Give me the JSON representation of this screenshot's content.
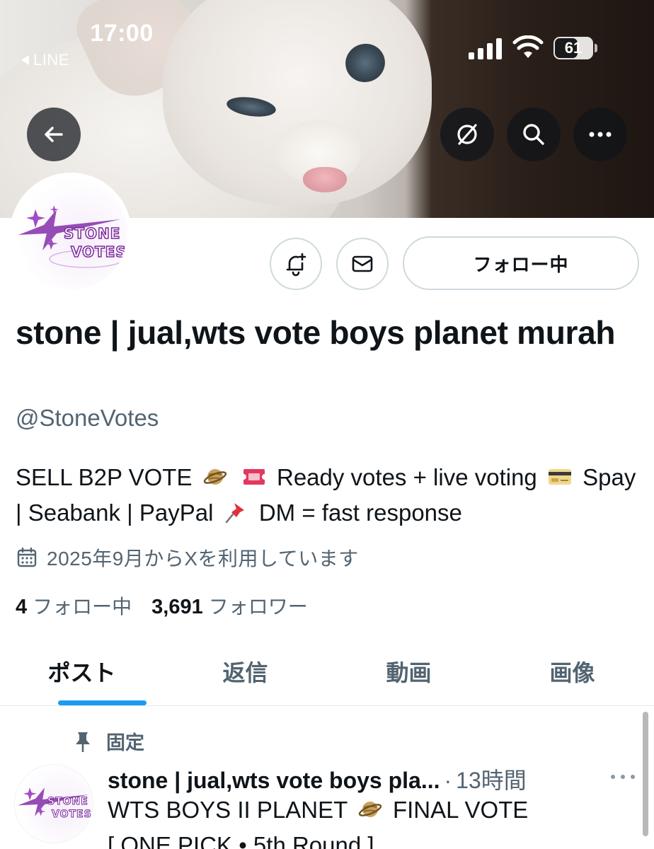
{
  "status_bar": {
    "time": "17:00",
    "back_app": "LINE",
    "battery_level": 61,
    "battery_label": "61"
  },
  "banner": {
    "description_icons": [
      "arrow-left-icon",
      "grok-icon",
      "search-icon",
      "more-icon"
    ]
  },
  "avatar": {
    "logo_line1": "STONE",
    "logo_line2": "VOTES"
  },
  "actions": {
    "following_label": "フォロー中"
  },
  "profile": {
    "display_name": "stone | jual,wts vote boys planet murah",
    "handle": "@StoneVotes",
    "bio": {
      "part1": "SELL B2P VOTE",
      "part2": "Ready votes + live voting",
      "part3": "Spay | Seabank | PayPal",
      "part4": "DM = fast response"
    },
    "joined": "2025年9月からXを利用しています",
    "following_count": "4",
    "following_label": "フォロー中",
    "followers_count": "3,691",
    "followers_label": "フォロワー"
  },
  "tabs": [
    {
      "label": "ポスト",
      "active": true
    },
    {
      "label": "返信",
      "active": false
    },
    {
      "label": "動画",
      "active": false
    },
    {
      "label": "画像",
      "active": false
    }
  ],
  "pinned_post": {
    "pinned_label": "固定",
    "author_name": "stone | jual,wts vote boys pla...",
    "separator": "·",
    "time": "13時間",
    "line1_a": "WTS BOYS II PLANET",
    "line1_b": "FINAL VOTE",
    "line2": "[ ONE PICK • 5th Round ]"
  },
  "colors": {
    "accent": "#1d9bf0",
    "text_primary": "#0f1419",
    "text_secondary": "#536471",
    "border": "#cfd9de",
    "logo_purple": "#7b2a9c"
  }
}
